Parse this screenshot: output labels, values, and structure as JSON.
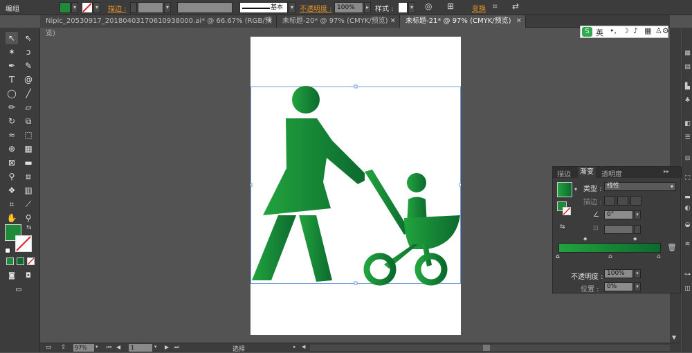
{
  "control_bar": {
    "group_label": "编组",
    "stroke_label": "描边 :",
    "stroke_style": "基本",
    "opacity_label": "不透明度 :",
    "opacity_value": "100%",
    "style_label": "样式 :",
    "transform_label": "变换"
  },
  "tabs": [
    {
      "label": "Nipic_20530917_20180403170610938000.ai* @ 66.67% (RGB/预览)"
    },
    {
      "label": "未标题-20* @ 97% (CMYK/预览)"
    },
    {
      "label": "未标题-21* @ 97% (CMYK/预览)"
    }
  ],
  "ime": {
    "label": "英"
  },
  "status": {
    "zoom": "97%",
    "page": "1",
    "tool": "选择"
  },
  "gradient_panel": {
    "tabs": [
      "描边",
      "渐变",
      "透明度"
    ],
    "type_label": "类型 :",
    "type_value": "线性",
    "stroke_label": "描边 :",
    "angle_value": "0°",
    "opacity_label": "不透明度 :",
    "opacity_value": "100%",
    "location_label": "位置 :",
    "location_value": "0%"
  },
  "colors": {
    "gradient_start": "#22a33e",
    "gradient_end": "#0b6a2e",
    "ui_dark": "#3c3c3c",
    "pasteboard": "#535353",
    "accent_orange": "#e3922a"
  }
}
